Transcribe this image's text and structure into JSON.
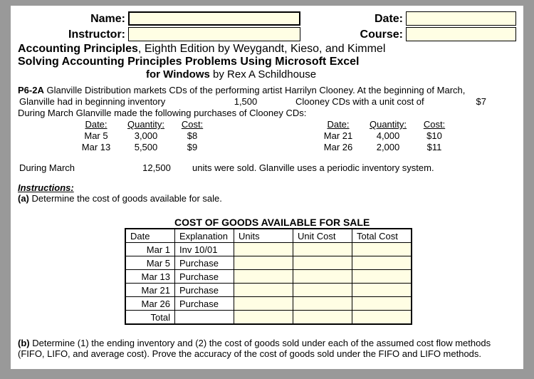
{
  "header": {
    "name_label": "Name:",
    "date_label": "Date:",
    "instructor_label": "Instructor:",
    "course_label": "Course:",
    "name_value": "",
    "date_value": "",
    "instructor_value": "",
    "course_value": ""
  },
  "titles": {
    "line1_bold": "Accounting Principles",
    "line1_rest": ", Eighth Edition by Weygandt, Kieso, and Kimmel",
    "line2": "Solving Accounting Principles Problems Using Microsoft Excel",
    "line3_bold": "for Windows",
    "line3_rest": " by Rex A Schildhouse"
  },
  "problem": {
    "code": "P6-2A",
    "intro1": " Glanville Distribution markets CDs of the performing artist Harrilyn Clooney. At the beginning of March,",
    "intro2a": "Glanville had in beginning inventory",
    "intro2_qty": "1,500",
    "intro2b": "Clooney CDs with a unit cost of",
    "intro2_cost": "$7",
    "intro3": "During March Glanville made the following purchases of Clooney CDs:",
    "col_date": "Date:",
    "col_qty": "Quantity:",
    "col_cost": "Cost:",
    "left": [
      {
        "date": "Mar 5",
        "qty": "3,000",
        "cost": "$8"
      },
      {
        "date": "Mar 13",
        "qty": "5,500",
        "cost": "$9"
      }
    ],
    "right": [
      {
        "date": "Mar 21",
        "qty": "4,000",
        "cost": "$10"
      },
      {
        "date": "Mar 26",
        "qty": "2,000",
        "cost": "$11"
      }
    ],
    "during_label": "During March",
    "during_qty": "12,500",
    "during_rest": "units were sold. Glanville uses a periodic inventory system."
  },
  "instructions": {
    "heading": "Instructions:",
    "part_a_bold": "(a)",
    "part_a_text": " Determine the cost of goods available for sale.",
    "part_b_bold": "(b)",
    "part_b_text": " Determine (1) the ending inventory and (2) the cost of goods sold under each of the assumed cost flow methods (FIFO, LIFO, and average cost). Prove the accuracy of the cost of goods sold under the FIFO and LIFO methods."
  },
  "cogs": {
    "title": "COST OF GOODS AVAILABLE FOR SALE",
    "h_date": "Date",
    "h_expl": "Explanation",
    "h_units": "Units",
    "h_unit_cost": "Unit Cost",
    "h_total": "Total Cost",
    "rows": [
      {
        "date": "Mar 1",
        "expl": "Inv 10/01"
      },
      {
        "date": "Mar 5",
        "expl": "Purchase"
      },
      {
        "date": "Mar 13",
        "expl": "Purchase"
      },
      {
        "date": "Mar 21",
        "expl": "Purchase"
      },
      {
        "date": "Mar 26",
        "expl": "Purchase"
      },
      {
        "date": "Total",
        "expl": ""
      }
    ]
  },
  "chart_data": {
    "type": "table",
    "title": "COST OF GOODS AVAILABLE FOR SALE",
    "columns": [
      "Date",
      "Explanation",
      "Units",
      "Unit Cost",
      "Total Cost"
    ],
    "rows": [
      [
        "Mar 1",
        "Inv 10/01",
        null,
        null,
        null
      ],
      [
        "Mar 5",
        "Purchase",
        null,
        null,
        null
      ],
      [
        "Mar 13",
        "Purchase",
        null,
        null,
        null
      ],
      [
        "Mar 21",
        "Purchase",
        null,
        null,
        null
      ],
      [
        "Mar 26",
        "Purchase",
        null,
        null,
        null
      ],
      [
        "Total",
        "",
        null,
        null,
        null
      ]
    ]
  }
}
